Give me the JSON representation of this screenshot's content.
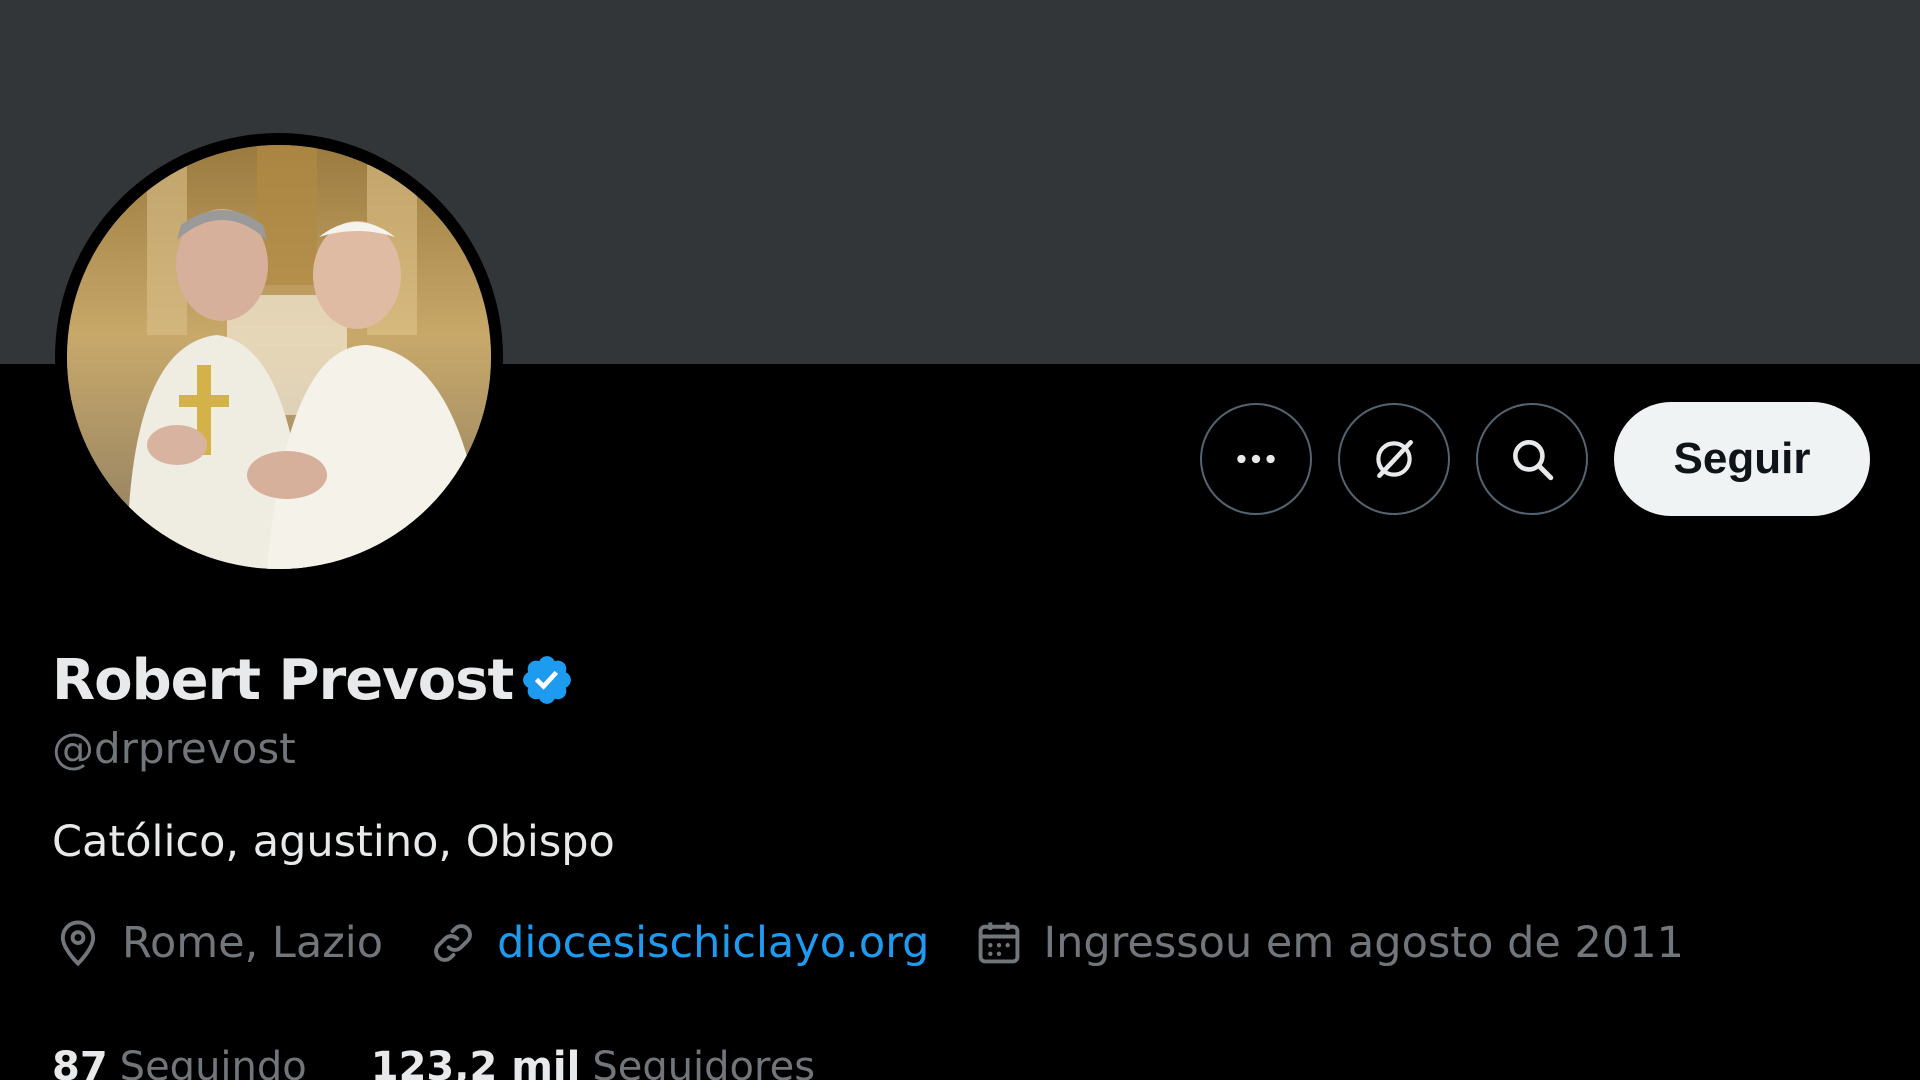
{
  "profile": {
    "display_name": "Robert Prevost",
    "handle": "@drprevost",
    "bio": "Católico, agustino, Obispo",
    "location": "Rome, Lazio",
    "website": "diocesischiclayo.org",
    "joined": "Ingressou em agosto de 2011",
    "verified": true
  },
  "actions": {
    "more_icon": "more-horizontal-icon",
    "grok_icon": "grok-icon",
    "search_icon": "search-icon",
    "follow_label": "Seguir"
  },
  "stats": {
    "following_count": "87",
    "following_label": "Seguindo",
    "followers_count": "123,2 mil",
    "followers_label": "Seguidores"
  },
  "colors": {
    "banner": "#333639",
    "background": "#000000",
    "accent": "#1d9bf0",
    "muted": "#71767b",
    "follow_bg": "#eff3f4"
  }
}
